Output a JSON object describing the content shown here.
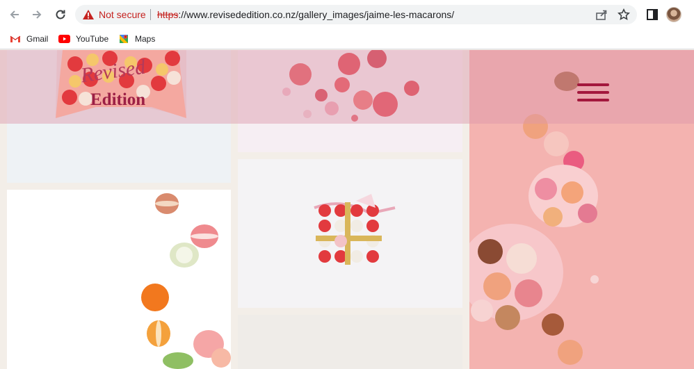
{
  "browser": {
    "security_label": "Not secure",
    "url_scheme": "https",
    "url_rest": "://www.revisededition.co.nz/gallery_images/jaime-les-macarons/",
    "icons": [
      "back-icon",
      "forward-icon",
      "reload-icon",
      "warning-icon",
      "share-icon",
      "star-icon",
      "side-panel-icon",
      "profile-avatar"
    ]
  },
  "bookmarks": [
    {
      "label": "Gmail",
      "icon": "gmail-icon"
    },
    {
      "label": "YouTube",
      "icon": "youtube-icon"
    },
    {
      "label": "Maps",
      "icon": "maps-icon"
    }
  ],
  "site": {
    "logo_script": "Revised",
    "logo_title": "Edition",
    "menu_icon": "hamburger-menu-icon"
  },
  "colors": {
    "brand": "#9c1f45",
    "header_tint": "#dc96aa",
    "background": "#f3eee8"
  }
}
